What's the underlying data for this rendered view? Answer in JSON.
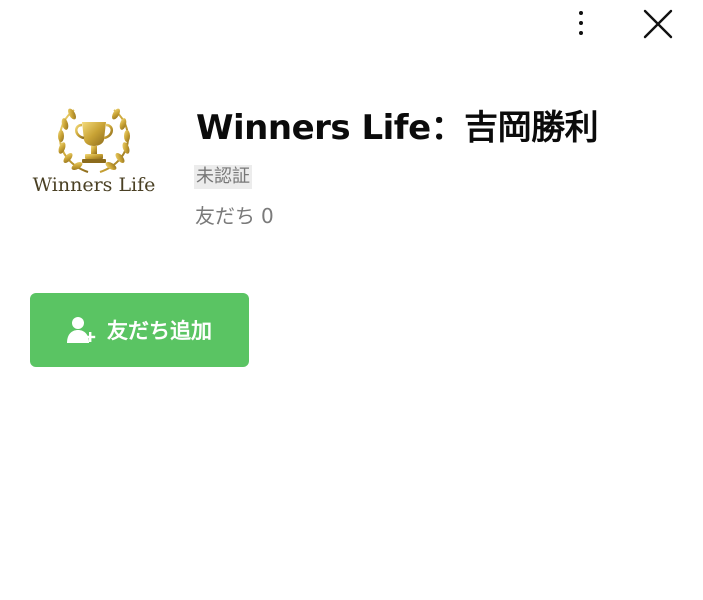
{
  "header": {
    "more_icon": "more-vertical-icon",
    "close_icon": "close-icon"
  },
  "profile": {
    "logo_text": "Winners Life",
    "logo_icon": "trophy-laurel-icon",
    "name": "Winners Life：吉岡勝利",
    "verification_status": "未認証",
    "friends_label": "友だち",
    "friends_count": "0"
  },
  "actions": {
    "add_friend_label": "友だち追加",
    "add_friend_icon": "add-user-icon"
  },
  "colors": {
    "accent": "#5ac463",
    "gold": "#c9a335",
    "badge_bg": "#ececec",
    "muted_text": "#7a7a7a"
  }
}
